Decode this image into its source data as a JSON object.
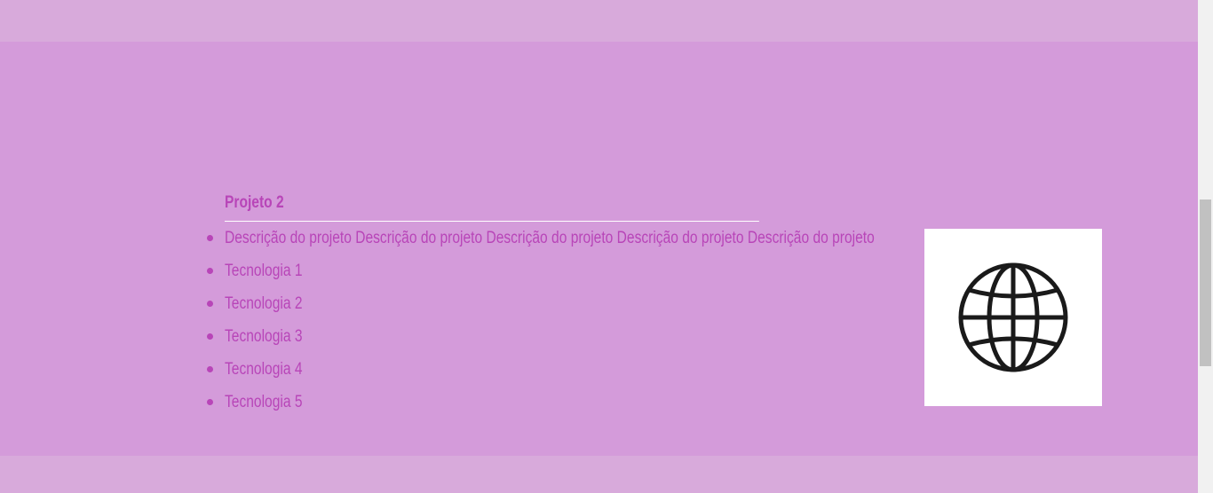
{
  "project": {
    "title": "Projeto 2",
    "items": [
      "Descrição do projeto Descrição do projeto Descrição do projeto Descrição do projeto Descrição do projeto",
      "Tecnologia 1",
      "Tecnologia 2",
      "Tecnologia 3",
      "Tecnologia 4",
      "Tecnologia 5"
    ],
    "image_icon": "globe-icon"
  },
  "colors": {
    "band_light": "#d8aadb",
    "band_main": "#d49bda",
    "text_accent": "#b845b8",
    "scrollbar_track": "#f1f1f1",
    "scrollbar_thumb": "#c1c1c1"
  }
}
